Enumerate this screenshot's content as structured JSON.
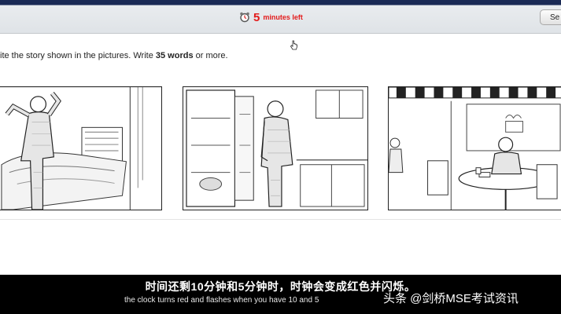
{
  "timer": {
    "minutes": "5",
    "label": "minutes left",
    "color": "#e31b1b",
    "icon": "alarm-clock-icon"
  },
  "header": {
    "see_button_label": "Se"
  },
  "instruction": {
    "prefix": "ite the story shown in the pictures. Write ",
    "word_count": "35 words",
    "suffix": " or more."
  },
  "pictures": [
    {
      "label": "man-waking-up-stretching"
    },
    {
      "label": "man-looking-in-empty-fridge"
    },
    {
      "label": "man-in-cafe"
    }
  ],
  "subtitles": {
    "chinese": "时间还剩10分钟和5分钟时，时钟会变成红色并闪烁。",
    "english": "the clock turns red and flashes when you have 10 and 5",
    "watermark": "头条 @剑桥MSE考试资讯"
  }
}
